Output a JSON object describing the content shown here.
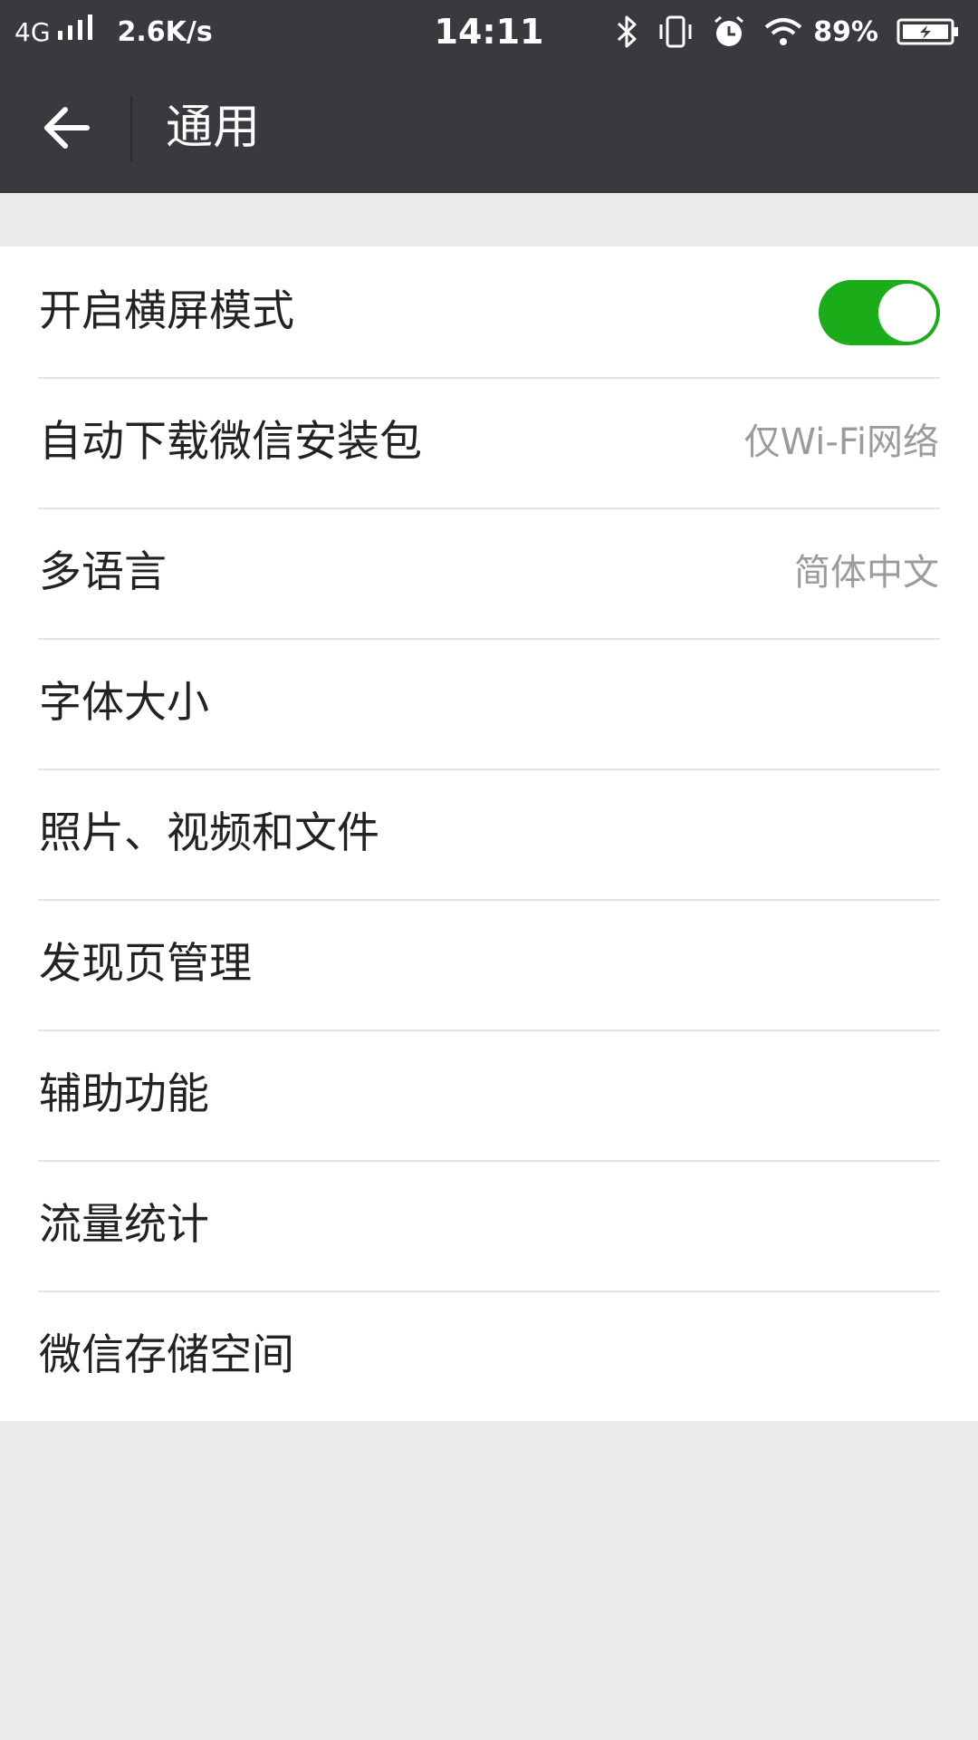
{
  "status_bar": {
    "network": "4G",
    "speed": "2.6K/s",
    "time": "14:11",
    "battery": "89%",
    "icons": [
      "signal-icon",
      "bluetooth-icon",
      "vibrate-icon",
      "alarm-icon",
      "wifi-icon",
      "battery-charging-icon"
    ]
  },
  "header": {
    "back_icon": "arrow-left-icon",
    "title": "通用"
  },
  "settings": {
    "items": [
      {
        "label": "开启横屏模式",
        "toggle_on": true
      },
      {
        "label": "自动下载微信安装包",
        "value": "仅Wi-Fi网络"
      },
      {
        "label": "多语言",
        "value": "简体中文"
      },
      {
        "label": "字体大小"
      },
      {
        "label": "照片、视频和文件"
      },
      {
        "label": "发现页管理"
      },
      {
        "label": "辅助功能"
      },
      {
        "label": "流量统计"
      },
      {
        "label": "微信存储空间"
      }
    ]
  },
  "colors": {
    "header_bg": "#393a3f",
    "page_bg": "#ebebeb",
    "toggle_on": "#1aad19",
    "secondary_text": "#9b9b9b"
  }
}
